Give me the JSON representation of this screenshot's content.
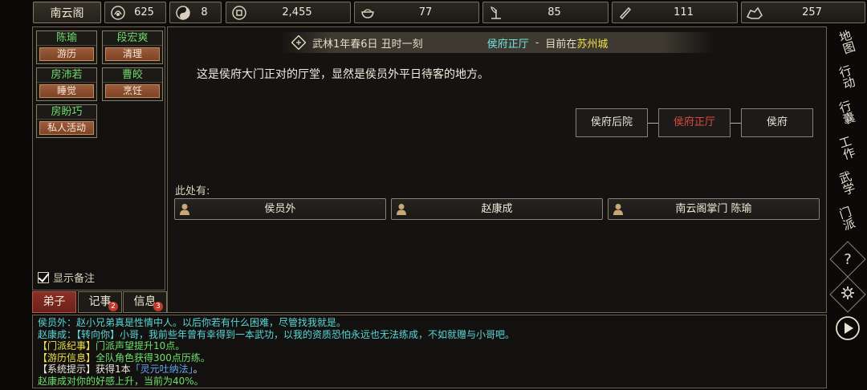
{
  "sect": {
    "name": "南云阁"
  },
  "resources": [
    {
      "icon": "coin-purse-icon",
      "value": "625"
    },
    {
      "icon": "yin-yang-icon",
      "value": "8"
    },
    {
      "icon": "copper-coin-icon",
      "value": "2,455"
    },
    {
      "icon": "food-bowl-icon",
      "value": "77"
    },
    {
      "icon": "herb-icon",
      "value": "85"
    },
    {
      "icon": "scroll-icon",
      "value": "111"
    },
    {
      "icon": "ore-icon",
      "value": "257"
    }
  ],
  "disciples": [
    {
      "name": "陈瑜",
      "status": "游历"
    },
    {
      "name": "段宏爽",
      "status": "清理"
    },
    {
      "name": "房沛若",
      "status": "睡觉"
    },
    {
      "name": "曹皎",
      "status": "烹饪"
    },
    {
      "name": "房盼巧",
      "status": "私人活动"
    }
  ],
  "show_notes_label": "显示备注",
  "tabs": [
    {
      "label": "弟子",
      "badge": ""
    },
    {
      "label": "记事",
      "badge": "2"
    },
    {
      "label": "信息",
      "badge": "3"
    }
  ],
  "location": {
    "date": "武林1年春6日 丑时一刻",
    "place": "侯府正厅",
    "separator": "-",
    "current_prefix": "目前在",
    "city": "苏州城",
    "description": "这是侯府大门正对的厅堂，显然是侯员外平日待客的地方。"
  },
  "rooms": [
    "侯府后院",
    "侯府正厅",
    "侯府"
  ],
  "here_label": "此处有:",
  "npcs": [
    "侯员外",
    "赵康成",
    "南云阁掌门 陈瑜"
  ],
  "right_menu": [
    {
      "label": "地图"
    },
    {
      "label": "行动"
    },
    {
      "label": "行囊"
    },
    {
      "label": "工作"
    },
    {
      "label": "武学"
    },
    {
      "label": "门派"
    },
    {
      "label": "?"
    },
    {
      "label": "settings"
    },
    {
      "label": "play"
    }
  ],
  "log": [
    {
      "parts": [
        {
          "c": "c-cyan",
          "t": "侯员外：赵小兄弟真是性情中人。以后你若有什么困难，尽管找我就是。"
        }
      ]
    },
    {
      "parts": [
        {
          "c": "c-cyan",
          "t": "赵康成：【转向你】小哥，我前些年曾有幸得到一本武功，以我的资质恐怕永远也无法练成，不如就赠与小哥吧。"
        }
      ]
    },
    {
      "parts": [
        {
          "c": "c-yellow",
          "t": "【门派纪事】"
        },
        {
          "c": "c-green",
          "t": "门派声望提升10点。"
        }
      ]
    },
    {
      "parts": [
        {
          "c": "c-yellow",
          "t": "【游历信息】"
        },
        {
          "c": "c-green",
          "t": "全队角色获得300点历练。"
        }
      ]
    },
    {
      "parts": [
        {
          "c": "c-white",
          "t": "【系统提示】获得1本"
        },
        {
          "c": "c-blue",
          "t": "「灵元吐纳法」"
        },
        {
          "c": "c-white",
          "t": "。"
        }
      ]
    },
    {
      "parts": [
        {
          "c": "c-green",
          "t": "赵康成对你的好感上升，当前为40%。"
        }
      ]
    }
  ]
}
